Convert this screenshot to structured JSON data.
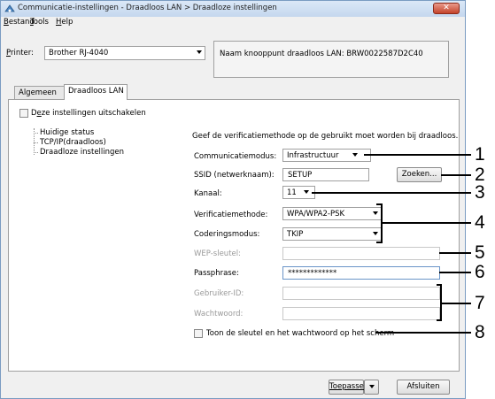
{
  "window": {
    "title": "Communicatie-instellingen - Draadloos LAN > Draadloze instellingen",
    "close_glyph": "✕"
  },
  "menu": [
    {
      "accel": "B",
      "rest": "estand"
    },
    {
      "accel": "T",
      "rest": "ools"
    },
    {
      "accel": "H",
      "rest": "elp"
    }
  ],
  "printer": {
    "label_accel": "P",
    "label_rest": "rinter:",
    "selected": "Brother RJ-4040",
    "node_name": "Naam knooppunt draadloos LAN: BRW0022587D2C40"
  },
  "tabs": [
    "Algemeen",
    "Draadloos LAN"
  ],
  "disable_settings": {
    "label_pre": "D",
    "label_accel": "e",
    "label_post": "ze instellingen uitschakelen"
  },
  "tree": [
    "Huidige status",
    "TCP/IP(draadloos)",
    "Draadloze instellingen"
  ],
  "form": {
    "instruction": "Geef de verificatiemethode op de gebruikt moet worden bij draadloos.",
    "comm_mode_label": "Communicatiemodus:",
    "comm_mode_value": "Infrastructuur",
    "ssid_label": "SSID (netwerknaam):",
    "ssid_value": "SETUP",
    "search_button": "Zoeken...",
    "channel_label": "Kanaal:",
    "channel_value": "11",
    "auth_label": "Verificatiemethode:",
    "auth_value": "WPA/WPA2-PSK",
    "enc_label": "Coderingsmodus:",
    "enc_value": "TKIP",
    "wep_label": "WEP-sleutel:",
    "passphrase_label": "Passphrase:",
    "passphrase_value": "*************",
    "userid_label": "Gebruiker-ID:",
    "password_label": "Wachtwoord:",
    "show_key_label": "Toon de sleutel en het wachtwoord op het scherm"
  },
  "footer": {
    "apply_label": "Toepassen",
    "close_label": "Afsluiten"
  },
  "callouts": [
    "1",
    "2",
    "3",
    "4",
    "5",
    "6",
    "7",
    "8"
  ]
}
